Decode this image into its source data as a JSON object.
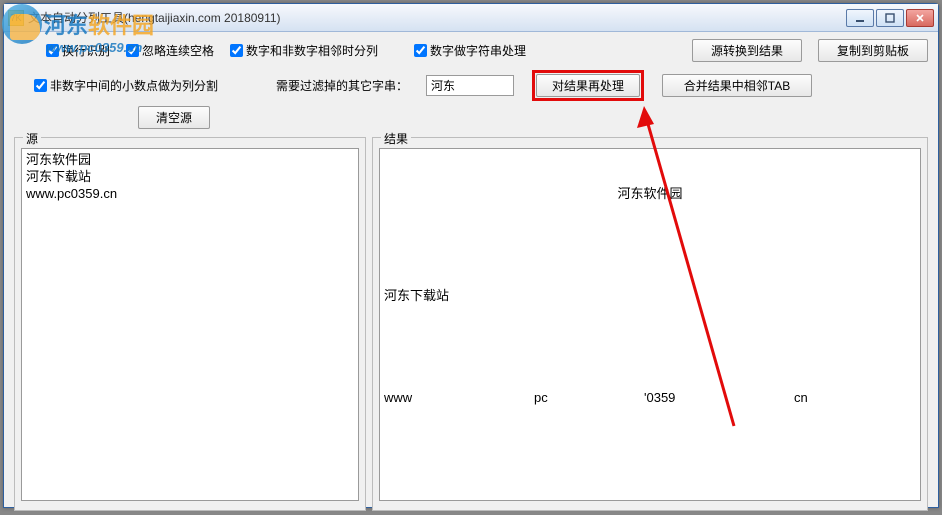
{
  "window": {
    "title": "文本自动分列工具(hengtaijiaxin.com 20180911)"
  },
  "watermark": {
    "name_a": "河东",
    "name_b": "软件园",
    "url": "www.pc0359.cn"
  },
  "row1": {
    "cb1": "换行识别",
    "cb2": "忽略连续空格",
    "cb3": "数字和非数字相邻时分列",
    "cb4": "数字做字符串处理",
    "btn1": "源转换到结果",
    "btn2": "复制到剪贴板"
  },
  "row2": {
    "cb5": "非数字中间的小数点做为列分割",
    "filter_label": "需要过滤掉的其它字串：",
    "filter_value": "河东",
    "btn_reprocess": "对结果再处理",
    "btn_merge": "合并结果中相邻TAB",
    "btn_clear": "清空源"
  },
  "group": {
    "src_label": "源",
    "res_label": "结果"
  },
  "source_text": "河东软件园\n河东下载站\nwww.pc0359.cn",
  "result": {
    "line1": "河东软件园",
    "line2": "河东下载站",
    "col1": "www",
    "col2": "pc",
    "col3": "'0359",
    "col4": "cn"
  }
}
